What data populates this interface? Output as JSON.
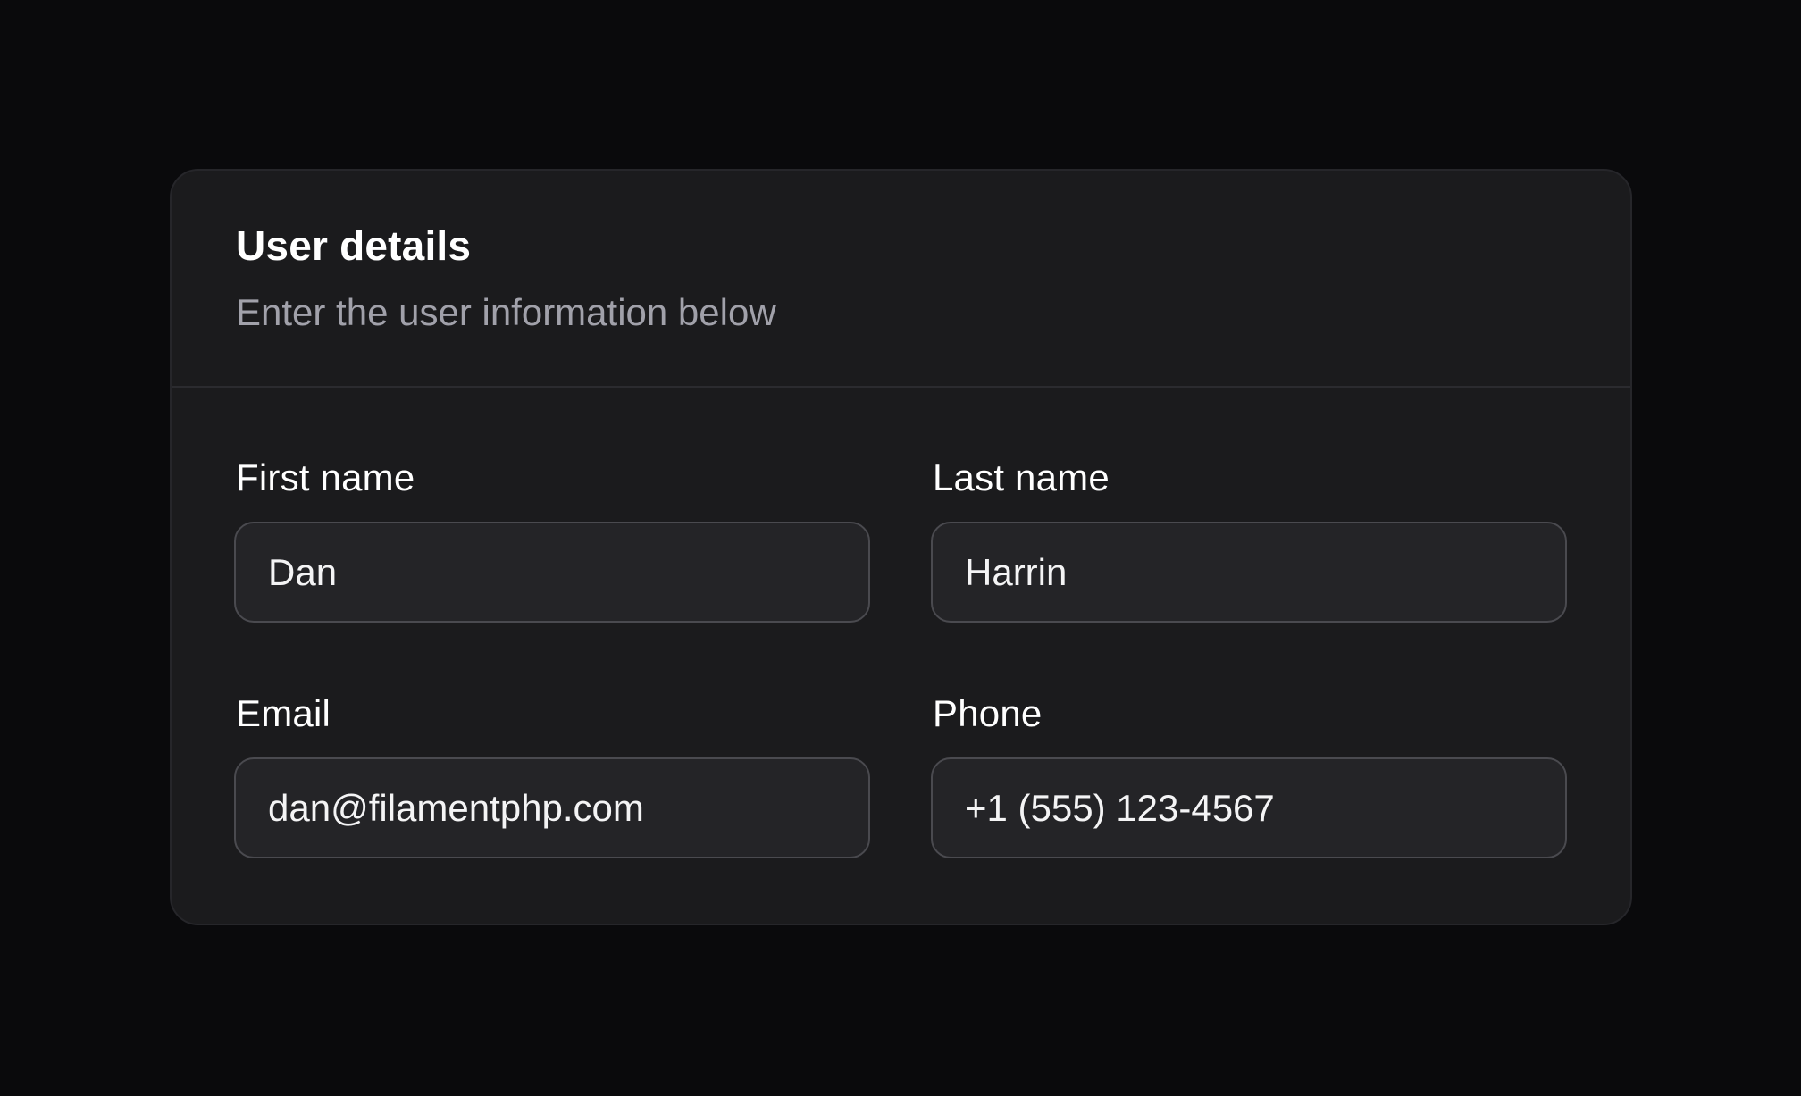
{
  "card": {
    "title": "User details",
    "description": "Enter the user information below"
  },
  "fields": {
    "first_name": {
      "label": "First name",
      "value": "Dan"
    },
    "last_name": {
      "label": "Last name",
      "value": "Harrin"
    },
    "email": {
      "label": "Email",
      "value": "dan@filamentphp.com"
    },
    "phone": {
      "label": "Phone",
      "value": "+1 (555) 123-4567"
    }
  },
  "colors": {
    "page_background": "#0a0a0c",
    "card_background": "#1b1b1d",
    "input_background": "#242427",
    "input_border": "#4a4a4f",
    "muted_text": "#a1a1aa"
  }
}
